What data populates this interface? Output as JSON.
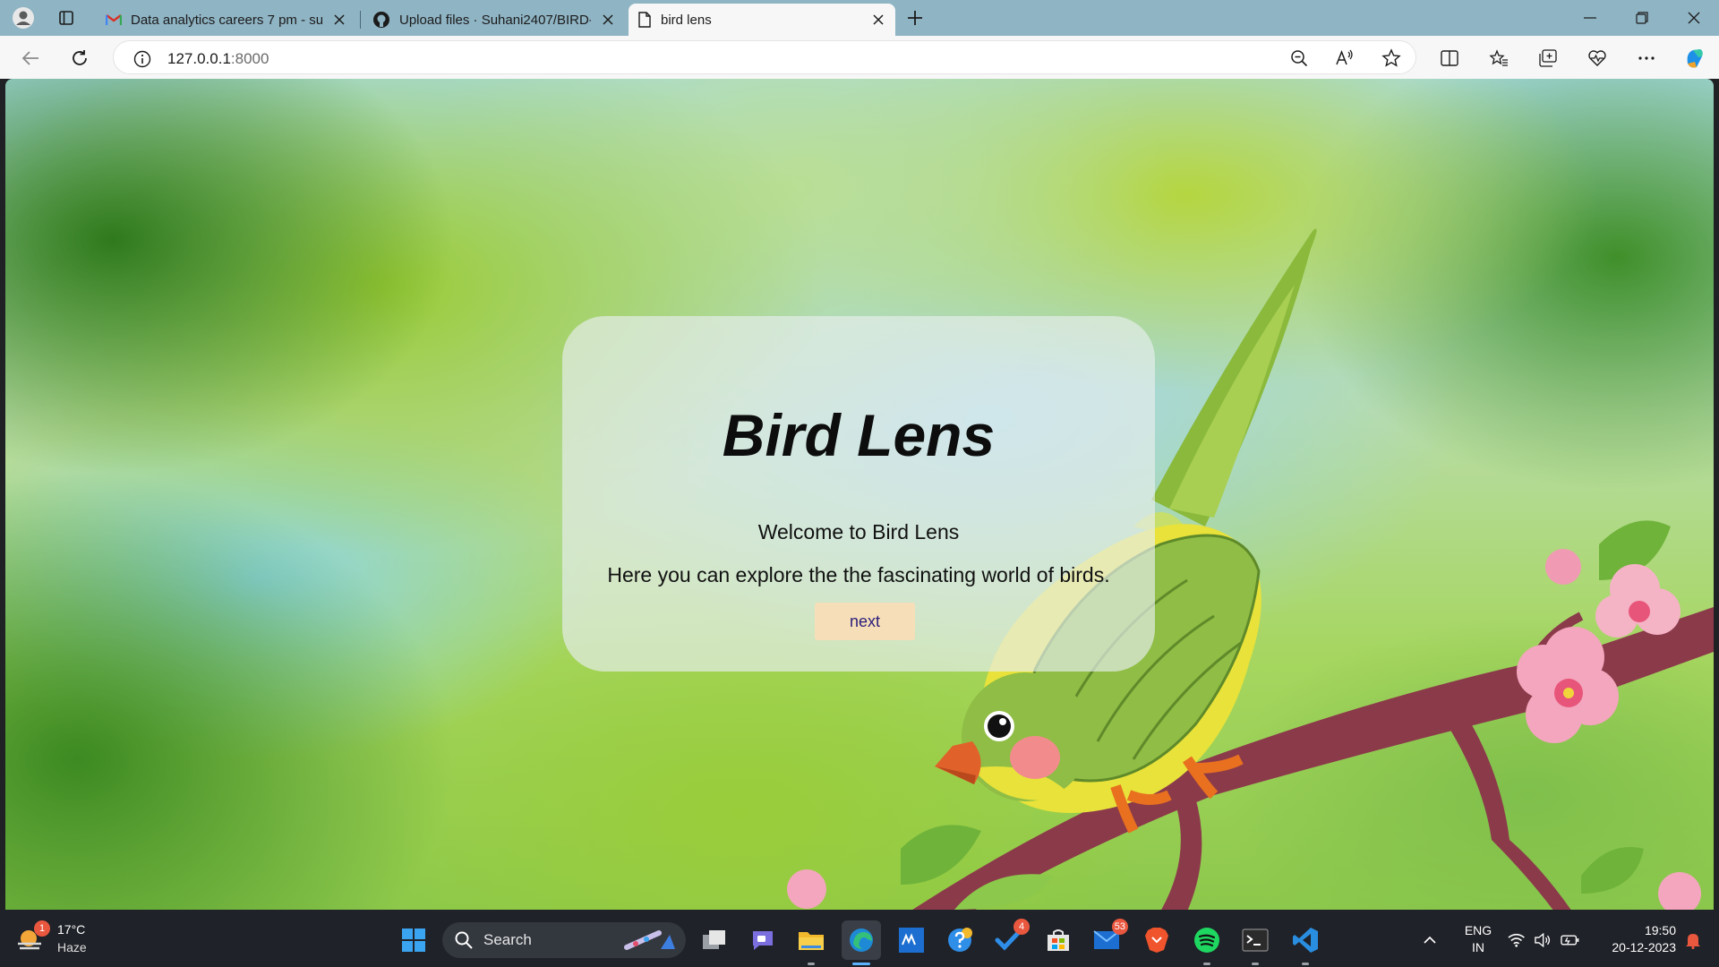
{
  "browser": {
    "tabs": [
      {
        "title": "Data analytics careers 7 pm - suh",
        "icon": "gmail-icon"
      },
      {
        "title": "Upload files · Suhani2407/BIRD-L",
        "icon": "github-icon"
      },
      {
        "title": "bird lens",
        "icon": "page-icon"
      }
    ],
    "url_host": "127.0.0.1",
    "url_port": ":8000"
  },
  "page": {
    "title": "Bird Lens",
    "welcome": "Welcome to Bird Lens",
    "description": "Here you can explore the the fascinating world of birds.",
    "next_button": "next"
  },
  "taskbar": {
    "weather_temp": "17°C",
    "weather_desc": "Haze",
    "weather_badge": "1",
    "search_label": "Search",
    "badges": {
      "todo": "4",
      "mail": "53"
    },
    "language_line1": "ENG",
    "language_line2": "IN",
    "time": "19:50",
    "date": "20-12-2023"
  },
  "colors": {
    "tabbar": "#8fb4c4",
    "card": "#e6eeec",
    "next_button_bg": "#f6dfb8",
    "taskbar": "#1f2228"
  }
}
